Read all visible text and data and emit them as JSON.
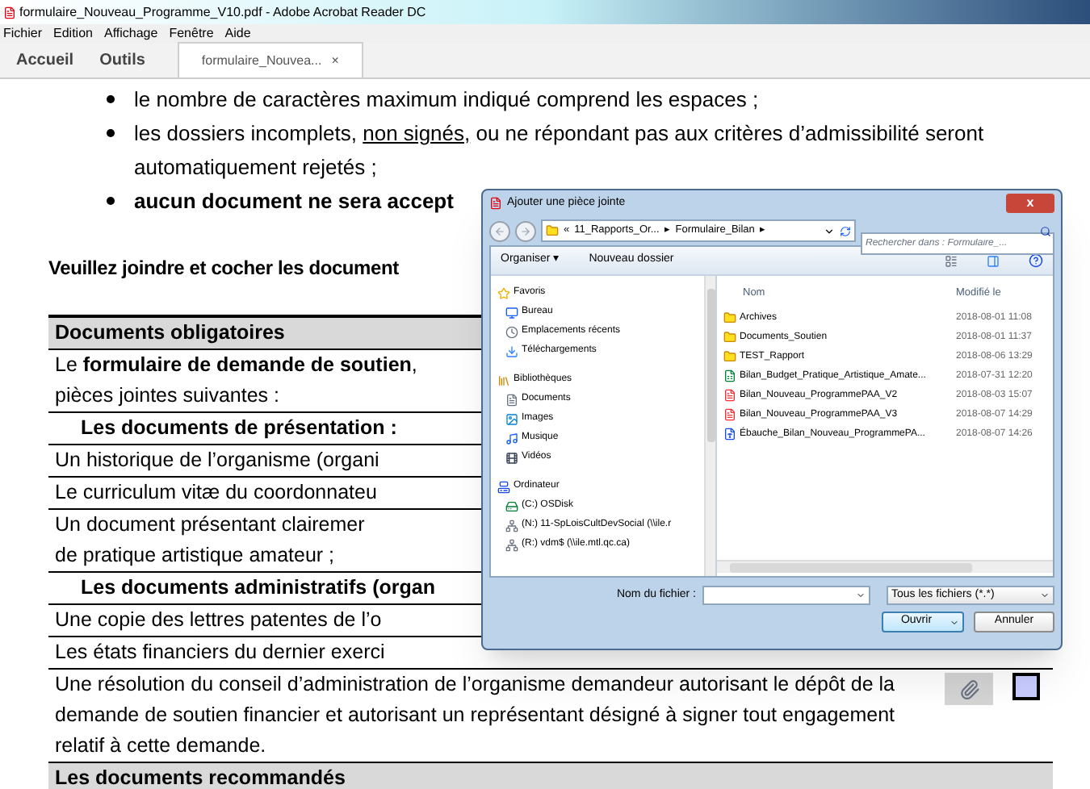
{
  "window": {
    "title": "formulaire_Nouveau_Programme_V10.pdf - Adobe Acrobat Reader DC"
  },
  "menu": [
    "Fichier",
    "Edition",
    "Affichage",
    "Fenêtre",
    "Aide"
  ],
  "tabs": [
    {
      "label": "Accueil",
      "kind": "nav",
      "selected": false
    },
    {
      "label": "Outils",
      "kind": "nav",
      "selected": false
    },
    {
      "label": "formulaire_Nouvea...",
      "kind": "document",
      "selected": true,
      "close": "×"
    }
  ],
  "document": {
    "bullets": [
      {
        "bold": false,
        "parts": [
          {
            "text": "le nombre de caractères maximum indiqué comprend les espaces ;",
            "underline": false
          }
        ]
      },
      {
        "bold": false,
        "parts": [
          {
            "text": "les dossiers incomplets, ",
            "underline": false
          },
          {
            "text": "non signés,",
            "underline": true
          },
          {
            "text": " ou ne répondant pas aux critères d’admissibilité seront automatiquement rejetés ;",
            "underline": false
          }
        ]
      },
      {
        "bold": true,
        "parts": [
          {
            "text": "aucun document ne sera accept",
            "underline": false
          }
        ]
      }
    ],
    "instruction": "Veuillez joindre et cocher les document",
    "table": {
      "header": "Documents obligatoires",
      "rows": [
        {
          "kind": "text",
          "text": "Le **formulaire de demande de soutien**,\npièces jointes suivantes :"
        },
        {
          "kind": "section",
          "text": "Les documents de présentation :"
        },
        {
          "kind": "text",
          "text": "Un historique de l’organisme (organi"
        },
        {
          "kind": "text",
          "text": "Le curriculum vitæ du coordonnateu"
        },
        {
          "kind": "text",
          "text": "Un document présentant clairemer\nde pratique artistique amateur ;"
        },
        {
          "kind": "section",
          "text": "Les documents administratifs (organ"
        },
        {
          "kind": "text",
          "text": "Une copie des lettres patentes de l’o"
        },
        {
          "kind": "text",
          "text": "Les états financiers du dernier exerci"
        },
        {
          "kind": "justified",
          "text": "Une résolution du conseil d’administration de l’organisme demandeur autorisant le dépôt de la demande de soutien financier et autorisant un représentant désigné à signer tout engagement relatif à cette demande.",
          "checked": false
        },
        {
          "kind": "header",
          "text": "Les documents recommandés"
        }
      ]
    }
  },
  "dialog": {
    "title": "Ajouter une pièce jointe",
    "close": "x",
    "breadcrumb": [
      "«",
      "11_Rapports_Or...",
      "▸",
      "Formulaire_Bilan",
      "▸"
    ],
    "search": {
      "placeholder": "Rechercher dans : Formulaire_..."
    },
    "toolbar": [
      "Organiser ▾",
      "Nouveau dossier"
    ],
    "nav": [
      {
        "label": "Favoris",
        "kind": "star",
        "children": [
          {
            "label": "Bureau",
            "kind": "desktop"
          },
          {
            "label": "Emplacements récents",
            "kind": "recent"
          },
          {
            "label": "Téléchargements",
            "kind": "download"
          }
        ]
      },
      {
        "label": "Bibliothèques",
        "kind": "library",
        "children": [
          {
            "label": "Documents",
            "kind": "doc"
          },
          {
            "label": "Images",
            "kind": "image"
          },
          {
            "label": "Musique",
            "kind": "music"
          },
          {
            "label": "Vidéos",
            "kind": "video"
          }
        ]
      },
      {
        "label": "Ordinateur",
        "kind": "computer",
        "children": [
          {
            "label": "(C:) OSDisk",
            "kind": "disk"
          },
          {
            "label": "(N:) 11-SpLoisCultDevSocial (\\\\ile.r",
            "kind": "network"
          },
          {
            "label": "(R:) vdm$ (\\\\ile.mtl.qc.ca)",
            "kind": "network"
          }
        ]
      }
    ],
    "columns": [
      "Nom",
      "Modifié le"
    ],
    "files": [
      {
        "name": "Archives",
        "kind": "folder",
        "modified": "2018-08-01 11:08"
      },
      {
        "name": "Documents_Soutien",
        "kind": "folder",
        "modified": "2018-08-01 11:37"
      },
      {
        "name": "TEST_Rapport",
        "kind": "folder",
        "modified": "2018-08-06 13:29"
      },
      {
        "name": "Bilan_Budget_Pratique_Artistique_Amate...",
        "kind": "sheet",
        "modified": "2018-07-31 12:20"
      },
      {
        "name": "Bilan_Nouveau_ProgrammePAA_V2",
        "kind": "pdf",
        "modified": "2018-08-03 15:07"
      },
      {
        "name": "Bilan_Nouveau_ProgrammePAA_V3",
        "kind": "pdf",
        "modified": "2018-08-07 14:29"
      },
      {
        "name": "Ébauche_Bilan_Nouveau_ProgrammePA...",
        "kind": "word",
        "modified": "2018-08-07 14:26"
      }
    ],
    "filename_label": "Nom du fichier :",
    "filter": "Tous les fichiers (*.*)",
    "buttons": [
      "Ouvrir",
      "Annuler"
    ]
  }
}
